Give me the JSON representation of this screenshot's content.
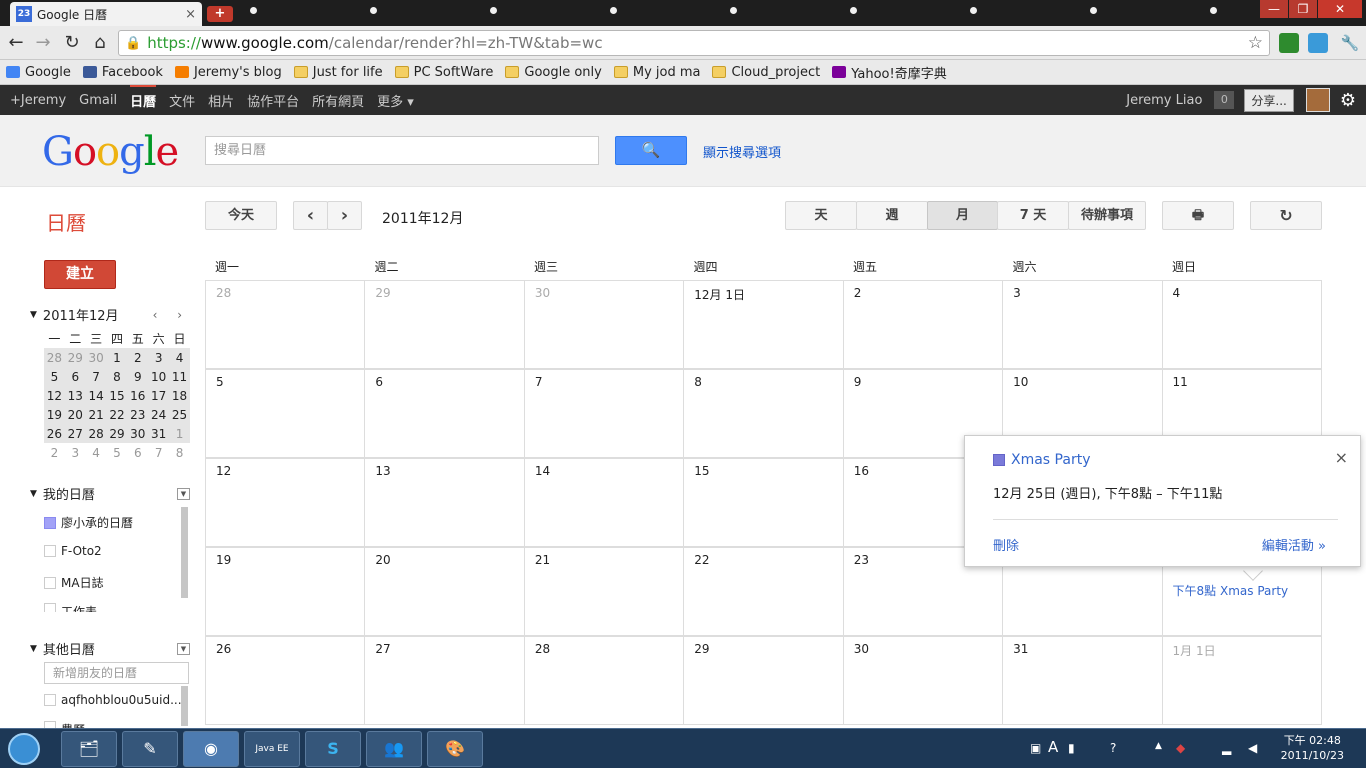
{
  "browser": {
    "tab_title": "Google 日曆",
    "tab_favicon": "23",
    "newtab_label": "+",
    "close_tab": "×",
    "window_controls": [
      "—",
      "❐",
      "✕"
    ],
    "url_scheme": "https://",
    "url_host": "www.google.com",
    "url_path": "/calendar/render?hl=zh-TW&tab=wc",
    "nav_back": "←",
    "nav_forward": "→",
    "nav_reload": "↻",
    "nav_home": "⌂",
    "star_icon": "☆",
    "lock_icon": "🔒",
    "wrench_icon": "🔧"
  },
  "bookmarks": [
    {
      "label": "Google",
      "icon": "google-icon",
      "color": "#4285f4"
    },
    {
      "label": "Facebook",
      "icon": "facebook-icon",
      "color": "#3b5998"
    },
    {
      "label": "Jeremy's blog",
      "icon": "blogger-icon",
      "color": "#f57d00"
    },
    {
      "label": "Just for life",
      "icon": "folder-icon"
    },
    {
      "label": "PC SoftWare",
      "icon": "folder-icon"
    },
    {
      "label": "Google only",
      "icon": "folder-icon"
    },
    {
      "label": "My jod ma",
      "icon": "folder-icon"
    },
    {
      "label": "Cloud_project",
      "icon": "folder-icon"
    },
    {
      "label": "Yahoo!奇摩字典",
      "icon": "yahoo-icon",
      "color": "#7b0099"
    }
  ],
  "gbar": {
    "items": [
      "+Jeremy",
      "Gmail",
      "日曆",
      "文件",
      "相片",
      "協作平台",
      "所有網頁",
      "更多 ▾"
    ],
    "active_index": 2,
    "user": "Jeremy Liao",
    "count": "0",
    "share": "分享...",
    "gear": "⚙"
  },
  "header": {
    "logo": [
      "G",
      "o",
      "o",
      "g",
      "l",
      "e"
    ],
    "logo_colors": [
      "#3369e8",
      "#d50f25",
      "#eeb211",
      "#3369e8",
      "#009925",
      "#d50f25"
    ],
    "search_placeholder": "搜尋日曆",
    "search_icon": "🔍",
    "search_options": "顯示搜尋選項"
  },
  "toolbar": {
    "title": "日曆",
    "today": "今天",
    "prev": "‹",
    "next": "›",
    "month": "2011年12月",
    "views": [
      "天",
      "週",
      "月",
      "7 天",
      "待辦事項"
    ],
    "selected_view": "月",
    "print_icon": "🖶",
    "refresh_icon": "↻"
  },
  "sidebar": {
    "create": "建立",
    "mini_title": "2011年12月",
    "mini_nav": "‹ ›",
    "mini_weekdays": [
      "一",
      "二",
      "三",
      "四",
      "五",
      "六",
      "日"
    ],
    "mini_weeks": [
      [
        "28",
        "29",
        "30",
        "1",
        "2",
        "3",
        "4"
      ],
      [
        "5",
        "6",
        "7",
        "8",
        "9",
        "10",
        "11"
      ],
      [
        "12",
        "13",
        "14",
        "15",
        "16",
        "17",
        "18"
      ],
      [
        "19",
        "20",
        "21",
        "22",
        "23",
        "24",
        "25"
      ],
      [
        "26",
        "27",
        "28",
        "29",
        "30",
        "31",
        "1"
      ],
      [
        "2",
        "3",
        "4",
        "5",
        "6",
        "7",
        "8"
      ]
    ],
    "my_calendars_title": "我的日曆",
    "my_calendars": [
      {
        "label": "廖小承的日曆",
        "checked": true
      },
      {
        "label": "F-Oto2",
        "checked": false
      },
      {
        "label": "MA日誌",
        "checked": false
      },
      {
        "label": "工作表",
        "checked": false
      }
    ],
    "other_calendars_title": "其他日曆",
    "friend_placeholder": "新增朋友的日曆",
    "other_calendars": [
      {
        "label": "aqfhohblou0u5uid...",
        "checked": false
      },
      {
        "label": "農曆",
        "checked": false
      }
    ]
  },
  "grid": {
    "weekdays": [
      "週一",
      "週二",
      "週三",
      "週四",
      "週五",
      "週六",
      "週日"
    ],
    "weeks": [
      [
        "28",
        "29",
        "30",
        "12月 1日",
        "2",
        "3",
        "4"
      ],
      [
        "5",
        "6",
        "7",
        "8",
        "9",
        "10",
        "11"
      ],
      [
        "12",
        "13",
        "14",
        "15",
        "16",
        "17",
        "18"
      ],
      [
        "19",
        "20",
        "21",
        "22",
        "23",
        "24",
        "25"
      ],
      [
        "26",
        "27",
        "28",
        "29",
        "30",
        "31",
        "1月 1日"
      ]
    ],
    "event": {
      "time": "下午8點",
      "title": "Xmas Party"
    }
  },
  "bubble": {
    "title": "Xmas Party",
    "when": "12月 25日 (週日), 下午8點 – 下午11點",
    "delete": "刪除",
    "edit": "編輯活動 »",
    "close": "×"
  },
  "taskbar": {
    "apps": [
      "🗂",
      "✎",
      "◉",
      "Java EE",
      "S",
      "👥",
      "🎨"
    ],
    "time": "下午 02:48",
    "date": "2011/10/23"
  }
}
